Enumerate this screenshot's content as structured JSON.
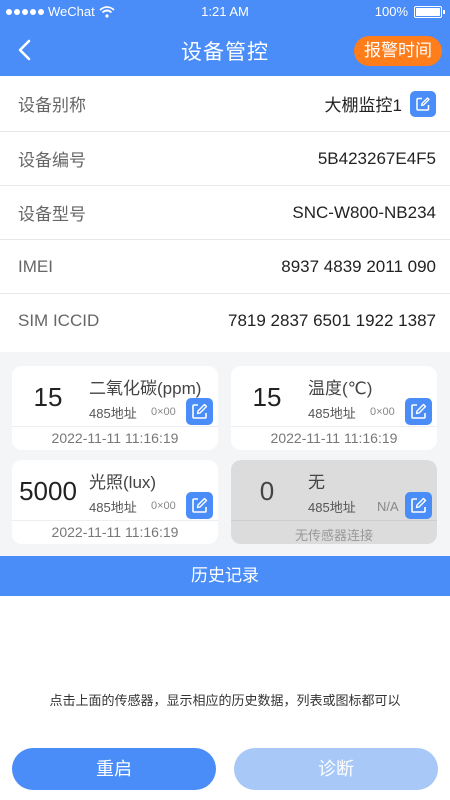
{
  "status_bar": {
    "carrier": "WeChat",
    "time": "1:21 AM",
    "battery": "100%"
  },
  "nav": {
    "title": "设备管控",
    "alarm_button": "报警时间",
    "back_icon": "chevron-left-icon"
  },
  "info_rows": [
    {
      "label": "设备别称",
      "value": "大棚监控1"
    },
    {
      "label": "设备编号",
      "value": "5B423267E4F5"
    },
    {
      "label": "设备型号",
      "value": "SNC-W800-NB234"
    },
    {
      "label": "IMEI",
      "value": "8937 4839 2011 090"
    },
    {
      "label": "SIM ICCID",
      "value": "7819 2837 6501 1922 1387"
    }
  ],
  "sensors": [
    {
      "value": "15",
      "name": "二氧化碳(ppm)",
      "addr_label": "485地址",
      "addr": "0×00",
      "time": "2022-11-11  11:16:19"
    },
    {
      "value": "15",
      "name": "温度(℃)",
      "addr_label": "485地址",
      "addr": "0×00",
      "time": "2022-11-11  11:16:19"
    },
    {
      "value": "5000",
      "name": "光照(lux)",
      "addr_label": "485地址",
      "addr": "0×00",
      "time": "2022-11-11  11:16:19"
    },
    {
      "value": "0",
      "name": "无",
      "addr_label": "485地址",
      "addr": "N/A",
      "time": "无传感器连接"
    }
  ],
  "history": {
    "title": "历史记录",
    "hint": "点击上面的传感器，显示相应的历史数据，列表或图标都可以"
  },
  "buttons": {
    "restart": "重启",
    "diagnose": "诊断"
  },
  "colors": {
    "primary": "#4a8df8",
    "alarm": "#ff7d1a",
    "disabled_button": "#a8c8f8"
  }
}
